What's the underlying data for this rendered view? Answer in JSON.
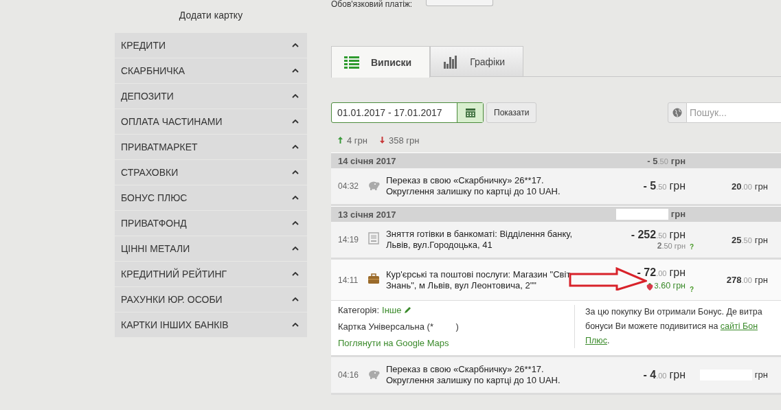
{
  "top": {
    "label": "Обов'язковий платіж:"
  },
  "sidebar": {
    "add_card": "Додати картку",
    "items": [
      {
        "label": "КРЕДИТИ"
      },
      {
        "label": "СКАРБНИЧКА"
      },
      {
        "label": "ДЕПОЗИТИ"
      },
      {
        "label": "ОПЛАТА ЧАСТИНАМИ"
      },
      {
        "label": "ПРИВАТМАРКЕТ"
      },
      {
        "label": "СТРАХОВКИ"
      },
      {
        "label": "БОНУС ПЛЮС"
      },
      {
        "label": "ПРИВАТФОНД"
      },
      {
        "label": "ЦІННІ МЕТАЛИ"
      },
      {
        "label": "КРЕДИТНИЙ РЕЙТИНГ"
      },
      {
        "label": "РАХУНКИ ЮР. ОСОБИ"
      },
      {
        "label": "КАРТКИ ІНШИХ БАНКІВ"
      }
    ]
  },
  "tabs": [
    {
      "label": "Виписки",
      "kind": "list",
      "selected": true
    },
    {
      "label": "Графіки",
      "kind": "chart",
      "selected": false
    }
  ],
  "filter": {
    "date_range": "01.01.2017 - 17.01.2017",
    "show_button": "Показати",
    "search_placeholder": "Пошук..."
  },
  "summary": {
    "income": "4 грн",
    "expense": "358 грн"
  },
  "days": [
    {
      "date": "14 січня 2017",
      "total": {
        "whole": "- 5",
        "cents": ".50",
        "currency": "грн"
      },
      "transactions": [
        {
          "time": "04:32",
          "kind": "piggy",
          "description": "Переказ в свою «Скарбничку» 26**17. Округлення залишку по картці до 10 UAH.",
          "amount": {
            "whole": "- 5",
            "cents": ".50",
            "currency": "грн"
          },
          "balance": {
            "whole": "20",
            "cents": ".00",
            "currency": "грн"
          },
          "expanded": false
        }
      ]
    },
    {
      "date": "13 січня 2017",
      "total": {
        "currency": "грн"
      },
      "transactions": [
        {
          "time": "14:19",
          "kind": "atm",
          "description": "Зняття готівки в банкоматі: Відділення банку, Львів, вул.Городоцька, 41",
          "amount": {
            "whole": "- 252",
            "cents": ".50",
            "currency": "грн"
          },
          "fee": {
            "kind": "commission",
            "whole": "2",
            "cents": ".50",
            "currency": "грн",
            "help": "?"
          },
          "balance": {
            "whole": "25",
            "cents": ".50",
            "currency": "грн"
          },
          "expanded": false
        },
        {
          "time": "14:11",
          "kind": "briefcase",
          "description": "Кур'єрські та поштові послуги: Магазин \"Світ Знань\", м Львів, вул Леонтовича, 2\"\"",
          "amount": {
            "whole": "- 72",
            "cents": ".00",
            "currency": "грн"
          },
          "fee": {
            "kind": "bonus",
            "whole": "3",
            "cents": ".60",
            "currency": "грн",
            "help": "?"
          },
          "balance": {
            "whole": "278",
            "cents": ".00",
            "currency": "грн"
          },
          "expanded": true,
          "details": {
            "category_label": "Категорія:",
            "category": "Інше",
            "card": "Картка Універсальна (*         )",
            "map_link": "Поглянути на Google Maps",
            "bonus_lines": [
              "За цю покупку Ви отримали Бонус. Де витра",
              "бонуси Ви можете подивитися на"
            ],
            "bonus_link": [
              "сайті Бон",
              "Плюс"
            ],
            "bonus_tail": "."
          }
        },
        {
          "time": "04:16",
          "kind": "piggy",
          "description": "Переказ в свою «Скарбничку» 26**17. Округлення залишку по картці до 10 UAH.",
          "amount": {
            "whole": "- 4",
            "cents": ".00",
            "currency": "грн"
          },
          "balance": {
            "currency": "грн"
          },
          "expanded": false
        }
      ]
    }
  ]
}
